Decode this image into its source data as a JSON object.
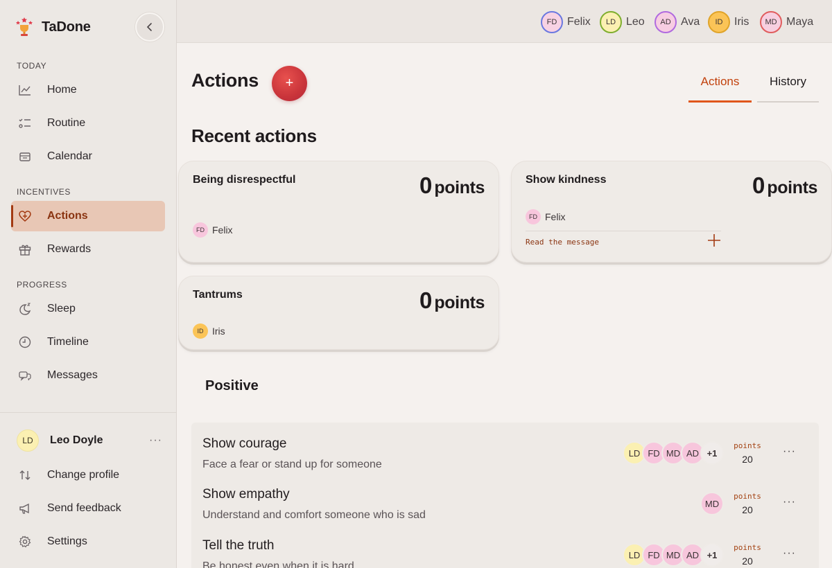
{
  "app": {
    "name": "TaDone"
  },
  "sidebar": {
    "sections": [
      {
        "title": "TODAY"
      },
      {
        "title": "INCENTIVES"
      },
      {
        "title": "PROGRESS"
      }
    ],
    "items": [
      {
        "label": "Home",
        "icon": "chart-line-icon"
      },
      {
        "label": "Routine",
        "icon": "checklist-icon"
      },
      {
        "label": "Calendar",
        "icon": "calendar-icon"
      },
      {
        "label": "Actions",
        "icon": "heart-plus-icon",
        "active": true
      },
      {
        "label": "Rewards",
        "icon": "gift-icon"
      },
      {
        "label": "Sleep",
        "icon": "moon-icon"
      },
      {
        "label": "Timeline",
        "icon": "clock-icon"
      },
      {
        "label": "Messages",
        "icon": "chat-icon"
      }
    ],
    "profile": {
      "initials": "LD",
      "name": "Leo Doyle",
      "more": "···"
    },
    "bottom_items": [
      {
        "label": "Change profile",
        "icon": "swap-icon"
      },
      {
        "label": "Send feedback",
        "icon": "megaphone-icon"
      },
      {
        "label": "Settings",
        "icon": "gear-icon"
      }
    ]
  },
  "topbar": {
    "members": [
      {
        "initials": "FD",
        "name": "Felix",
        "bg": "#f8d2e4",
        "border": "#6a78e0"
      },
      {
        "initials": "LD",
        "name": "Leo",
        "bg": "#fbf0b2",
        "border": "#7fae2e"
      },
      {
        "initials": "AD",
        "name": "Ava",
        "bg": "#f7cde2",
        "border": "#b06adf"
      },
      {
        "initials": "ID",
        "name": "Iris",
        "bg": "#fbc457",
        "border": "#e0a429"
      },
      {
        "initials": "MD",
        "name": "Maya",
        "bg": "#f7cfe0",
        "border": "#e05d5d"
      }
    ]
  },
  "main": {
    "title": "Actions",
    "add_label": "+",
    "tabs": [
      {
        "label": "Actions"
      },
      {
        "label": "History"
      }
    ],
    "recent_title": "Recent actions",
    "recent": [
      {
        "title": "Being disrespectful",
        "points": "0",
        "points_label": "points",
        "member_initials": "FD",
        "member_name": "Felix",
        "member_bg": "#f8c6dd"
      },
      {
        "title": "Show kindness",
        "points": "0",
        "points_label": "points",
        "member_initials": "FD",
        "member_name": "Felix",
        "member_bg": "#f8c6dd",
        "message": "Read the message"
      },
      {
        "title": "Tantrums",
        "points": "0",
        "points_label": "points",
        "member_initials": "ID",
        "member_name": "Iris",
        "member_bg": "#fbc457"
      }
    ],
    "positive_title": "Positive",
    "positive": [
      {
        "name": "Show courage",
        "desc": "Face a fear or stand up for someone",
        "avatars": [
          "LD",
          "FD",
          "MD",
          "AD",
          "+1"
        ],
        "points_label": "points",
        "points": "20",
        "more": "···"
      },
      {
        "name": "Show empathy",
        "desc": "Understand and comfort someone who is sad",
        "avatars": [
          "MD"
        ],
        "points_label": "points",
        "points": "20",
        "more": "···"
      },
      {
        "name": "Tell the truth",
        "desc": "Be honest even when it is hard",
        "avatars": [
          "LD",
          "FD",
          "MD",
          "AD",
          "+1"
        ],
        "points_label": "points",
        "points": "20",
        "more": "···"
      }
    ]
  },
  "colors": {
    "accent": "#e0561b",
    "active_bg": "#e8c7b5",
    "LD": "#fbf0b2",
    "FD": "#f8c6dd",
    "MD": "#f7c6dc",
    "AD": "#f7c6dc",
    "more": "#f0ecea"
  }
}
